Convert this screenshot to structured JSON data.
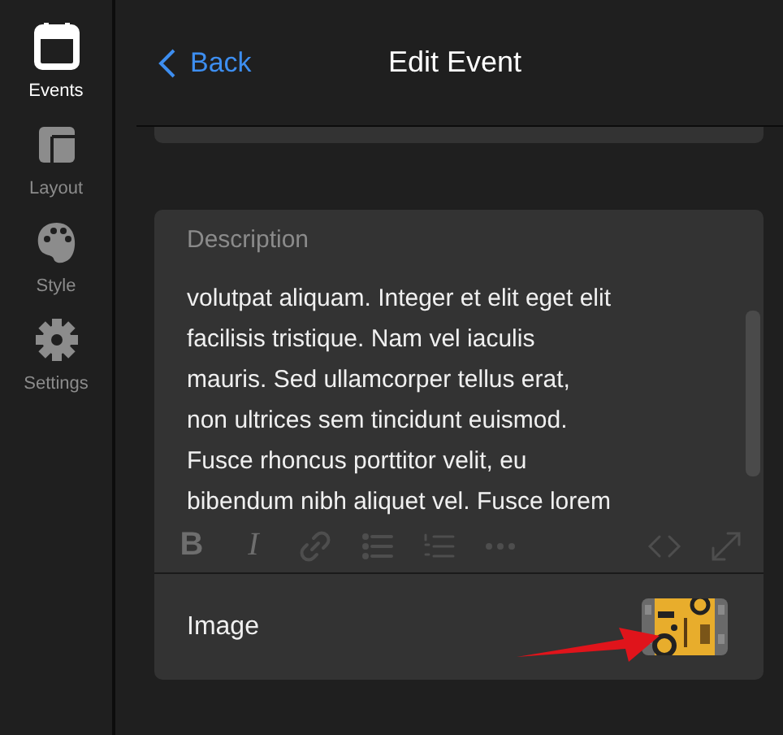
{
  "sidebar": {
    "items": [
      {
        "label": "Events",
        "kind": "calendar",
        "selected": true
      },
      {
        "label": "Layout",
        "kind": "layout",
        "selected": false
      },
      {
        "label": "Style",
        "kind": "palette",
        "selected": false
      },
      {
        "label": "Settings",
        "kind": "gear",
        "selected": false
      }
    ]
  },
  "header": {
    "back": "Back",
    "title": "Edit Event"
  },
  "description": {
    "label": "Description",
    "text": "volutpat aliquam. Integer et elit eget elit\nfacilisis tristique. Nam vel iaculis\nmauris. Sed ullamcorper tellus erat,\nnon ultrices sem tincidunt euismod.\nFusce rhoncus porttitor velit, eu\nbibendum nibh aliquet vel. Fusce lorem",
    "toolbar": [
      {
        "kind": "bold",
        "glyph": "B",
        "disabled": true
      },
      {
        "kind": "italic",
        "glyph": "I",
        "disabled": true
      },
      {
        "kind": "link",
        "disabled": true
      },
      {
        "kind": "bullets",
        "disabled": true
      },
      {
        "kind": "numbers",
        "disabled": true
      },
      {
        "kind": "more",
        "disabled": true
      },
      {
        "kind": "code",
        "disabled": true
      },
      {
        "kind": "expand",
        "disabled": true
      }
    ]
  },
  "image": {
    "label": "Image"
  },
  "annotation": {
    "kind": "arrow"
  }
}
